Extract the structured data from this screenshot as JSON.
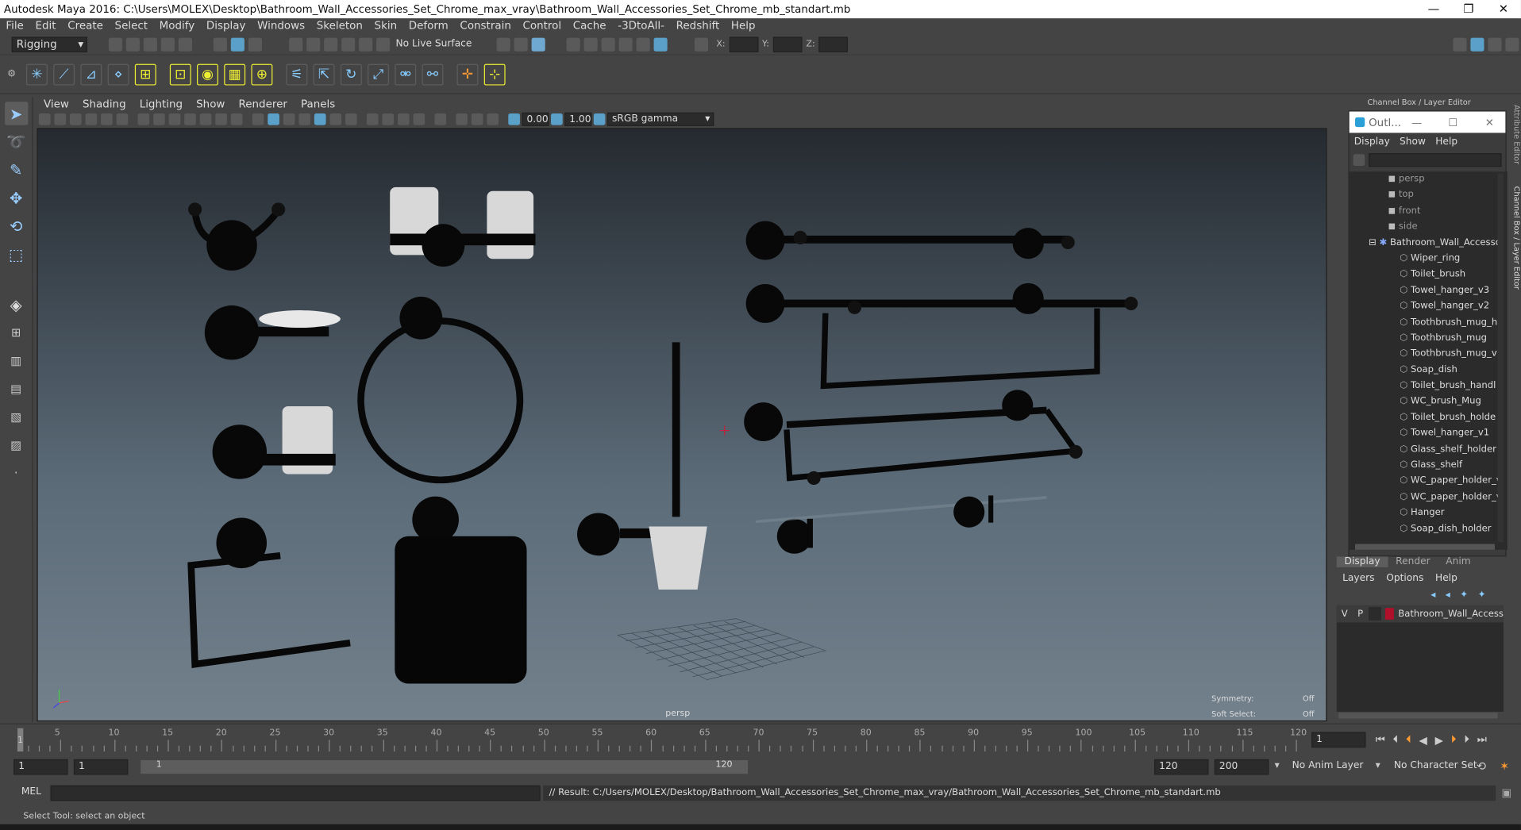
{
  "window": {
    "title": "Autodesk Maya 2016: C:\\Users\\MOLEX\\Desktop\\Bathroom_Wall_Accessories_Set_Chrome_max_vray\\Bathroom_Wall_Accessories_Set_Chrome_mb_standart.mb",
    "min_glyph": "—",
    "max_glyph": "❐",
    "close_glyph": "✕"
  },
  "menus": [
    "File",
    "Edit",
    "Create",
    "Select",
    "Modify",
    "Display",
    "Windows",
    "Skeleton",
    "Skin",
    "Deform",
    "Constrain",
    "Control",
    "Cache",
    "-3DtoAll-",
    "Redshift",
    "Help"
  ],
  "status": {
    "mode": "Rigging",
    "live_surface": "No Live Surface",
    "x_label": "X:",
    "y_label": "Y:",
    "z_label": "Z:"
  },
  "panel_menus": [
    "View",
    "Shading",
    "Lighting",
    "Show",
    "Renderer",
    "Panels"
  ],
  "panel_tools": {
    "exposure": "0.00",
    "gamma": "1.00",
    "color_space": "sRGB gamma"
  },
  "viewport": {
    "camera": "persp",
    "symmetry_label": "Symmetry:",
    "symmetry_value": "Off",
    "soft_select_label": "Soft Select:",
    "soft_select_value": "Off"
  },
  "right_panel": {
    "header": "Channel Box / Layer Editor",
    "side_tab_1": "Attribute Editor",
    "side_tab_2": "Channel Box / Layer Editor"
  },
  "outliner": {
    "title": "Outl...",
    "menus": [
      "Display",
      "Show",
      "Help"
    ],
    "cameras": [
      "persp",
      "top",
      "front",
      "side"
    ],
    "group": "Bathroom_Wall_Accesso",
    "children": [
      "Wiper_ring",
      "Toilet_brush",
      "Towel_hanger_v3",
      "Towel_hanger_v2",
      "Toothbrush_mug_h",
      "Toothbrush_mug",
      "Toothbrush_mug_v",
      "Soap_dish",
      "Toilet_brush_handl",
      "WC_brush_Mug",
      "Toilet_brush_holde",
      "Towel_hanger_v1",
      "Glass_shelf_holder",
      "Glass_shelf",
      "WC_paper_holder_v",
      "WC_paper_holder_v",
      "Hanger",
      "Soap_dish_holder"
    ]
  },
  "channel_tabs": [
    "Display",
    "Render",
    "Anim"
  ],
  "layer_menus": [
    "Layers",
    "Options",
    "Help"
  ],
  "layers": [
    {
      "v": "V",
      "p": "P",
      "color": "#b0102a",
      "name": "Bathroom_Wall_Access"
    }
  ],
  "timeline": {
    "ticks": [
      "5",
      "10",
      "15",
      "20",
      "25",
      "30",
      "35",
      "40",
      "45",
      "50",
      "55",
      "60",
      "65",
      "70",
      "75",
      "80",
      "85",
      "90",
      "95",
      "100",
      "105",
      "110",
      "115",
      "120"
    ],
    "current_frame": "1",
    "start_tick": "1"
  },
  "range": {
    "start": "1",
    "playback_start": "1",
    "slider_start": "1",
    "slider_end": "120",
    "playback_end": "120",
    "end": "200",
    "anim_layer": "No Anim Layer",
    "character_set": "No Character Set"
  },
  "command": {
    "label": "MEL",
    "result": "// Result: C:/Users/MOLEX/Desktop/Bathroom_Wall_Accessories_Set_Chrome_max_vray/Bathroom_Wall_Accessories_Set_Chrome_mb_standart.mb"
  },
  "help_line": "Select Tool: select an object"
}
